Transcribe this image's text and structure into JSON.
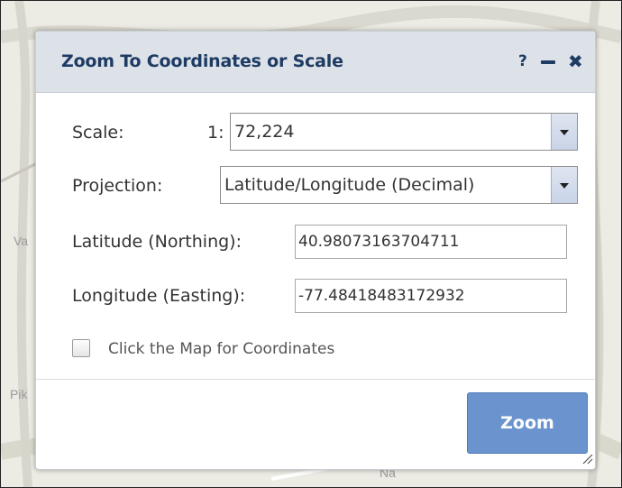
{
  "dialog": {
    "title": "Zoom To Coordinates or Scale",
    "help_label": "?",
    "close_label": "✖"
  },
  "scale": {
    "label": "Scale:",
    "prefix": "1:",
    "value": "72,224"
  },
  "projection": {
    "label": "Projection:",
    "value": "Latitude/Longitude (Decimal)"
  },
  "latitude": {
    "label": "Latitude (Northing):",
    "value": "40.98073163704711"
  },
  "longitude": {
    "label": "Longitude (Easting):",
    "value": "-77.48418483172932"
  },
  "map_click": {
    "label": "Click the Map for Coordinates",
    "checked": false
  },
  "actions": {
    "zoom_label": "Zoom"
  },
  "colors": {
    "title_bar": "#dde1e8",
    "title_text": "#1d3b63",
    "zoom_button": "#6b94cf"
  },
  "icons": [
    "help-icon",
    "minimize-icon",
    "close-icon",
    "dropdown-arrow-icon",
    "resize-grip-icon"
  ]
}
